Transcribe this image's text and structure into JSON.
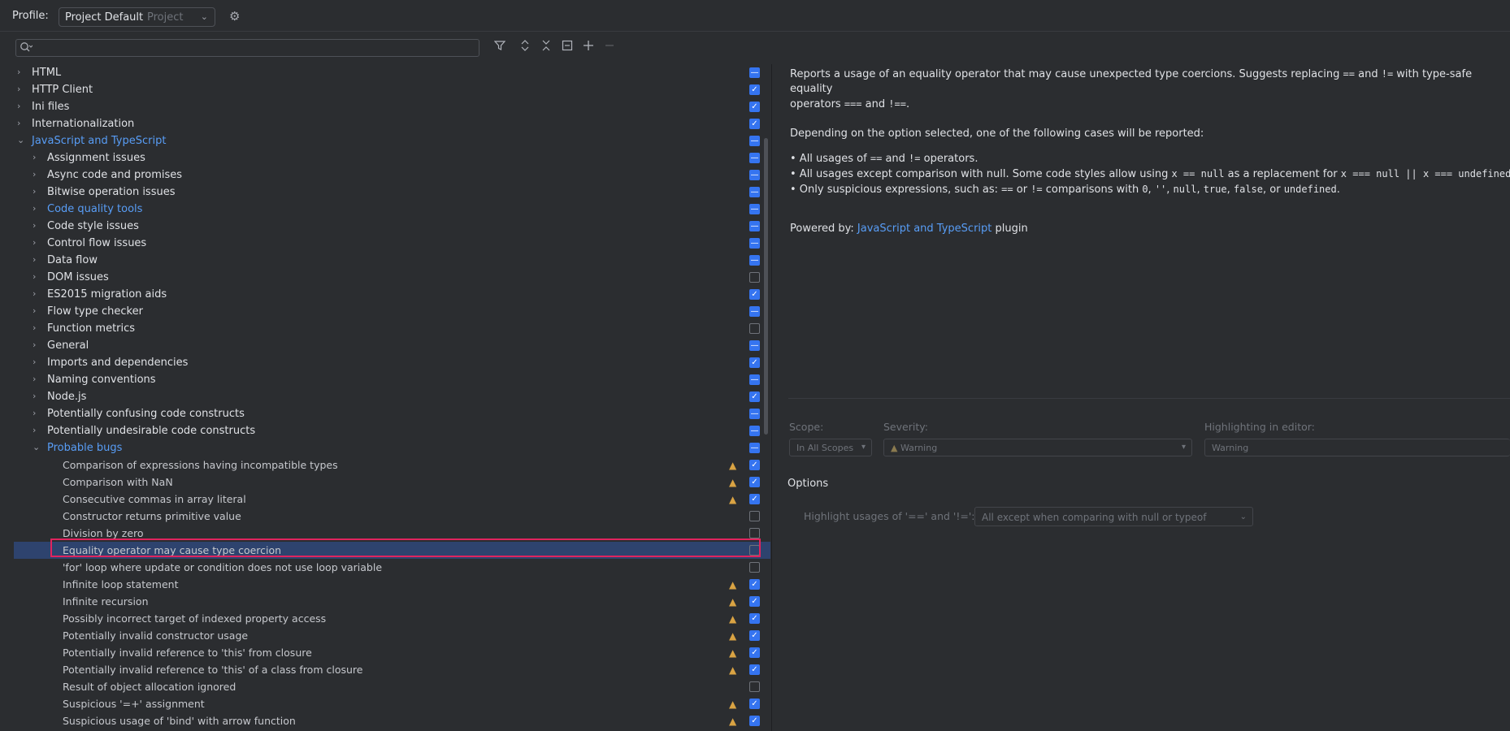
{
  "profile": {
    "label": "Profile:",
    "value": "Project Default",
    "scope": "Project"
  },
  "search": {
    "placeholder": ""
  },
  "tree": [
    {
      "label": "HTML",
      "level": 0,
      "chev": "right",
      "state": "mix"
    },
    {
      "label": "HTTP Client",
      "level": 0,
      "chev": "right",
      "state": "on"
    },
    {
      "label": "Ini files",
      "level": 0,
      "chev": "right",
      "state": "on"
    },
    {
      "label": "Internationalization",
      "level": 0,
      "chev": "right",
      "state": "on"
    },
    {
      "label": "JavaScript and TypeScript",
      "level": 0,
      "chev": "down",
      "state": "mix",
      "blue": true
    },
    {
      "label": "Assignment issues",
      "level": 1,
      "chev": "right",
      "state": "mix"
    },
    {
      "label": "Async code and promises",
      "level": 1,
      "chev": "right",
      "state": "mix"
    },
    {
      "label": "Bitwise operation issues",
      "level": 1,
      "chev": "right",
      "state": "mix"
    },
    {
      "label": "Code quality tools",
      "level": 1,
      "chev": "right",
      "state": "mix",
      "blue": true
    },
    {
      "label": "Code style issues",
      "level": 1,
      "chev": "right",
      "state": "mix"
    },
    {
      "label": "Control flow issues",
      "level": 1,
      "chev": "right",
      "state": "mix"
    },
    {
      "label": "Data flow",
      "level": 1,
      "chev": "right",
      "state": "mix"
    },
    {
      "label": "DOM issues",
      "level": 1,
      "chev": "right",
      "state": "off"
    },
    {
      "label": "ES2015 migration aids",
      "level": 1,
      "chev": "right",
      "state": "on"
    },
    {
      "label": "Flow type checker",
      "level": 1,
      "chev": "right",
      "state": "mix"
    },
    {
      "label": "Function metrics",
      "level": 1,
      "chev": "right",
      "state": "off"
    },
    {
      "label": "General",
      "level": 1,
      "chev": "right",
      "state": "mix"
    },
    {
      "label": "Imports and dependencies",
      "level": 1,
      "chev": "right",
      "state": "on"
    },
    {
      "label": "Naming conventions",
      "level": 1,
      "chev": "right",
      "state": "mix"
    },
    {
      "label": "Node.js",
      "level": 1,
      "chev": "right",
      "state": "on"
    },
    {
      "label": "Potentially confusing code constructs",
      "level": 1,
      "chev": "right",
      "state": "mix"
    },
    {
      "label": "Potentially undesirable code constructs",
      "level": 1,
      "chev": "right",
      "state": "mix"
    },
    {
      "label": "Probable bugs",
      "level": 1,
      "chev": "down",
      "state": "mix",
      "blue": true
    },
    {
      "label": "Comparison of expressions having incompatible types",
      "level": 2,
      "warn": true,
      "state": "on"
    },
    {
      "label": "Comparison with NaN",
      "level": 2,
      "warn": true,
      "state": "on"
    },
    {
      "label": "Consecutive commas in array literal",
      "level": 2,
      "warn": true,
      "state": "on"
    },
    {
      "label": "Constructor returns primitive value",
      "level": 2,
      "state": "off"
    },
    {
      "label": "Division by zero",
      "level": 2,
      "state": "off"
    },
    {
      "label": "Equality operator may cause type coercion",
      "level": 2,
      "state": "off",
      "selected": true
    },
    {
      "label": "'for' loop where update or condition does not use loop variable",
      "level": 2,
      "state": "off"
    },
    {
      "label": "Infinite loop statement",
      "level": 2,
      "warn": true,
      "state": "on"
    },
    {
      "label": "Infinite recursion",
      "level": 2,
      "warn": true,
      "state": "on"
    },
    {
      "label": "Possibly incorrect target of indexed property access",
      "level": 2,
      "warn": true,
      "state": "on"
    },
    {
      "label": "Potentially invalid constructor usage",
      "level": 2,
      "warn": true,
      "state": "on"
    },
    {
      "label": "Potentially invalid reference to 'this' from closure",
      "level": 2,
      "warn": true,
      "state": "on"
    },
    {
      "label": "Potentially invalid reference to 'this' of a class from closure",
      "level": 2,
      "warn": true,
      "state": "on"
    },
    {
      "label": "Result of object allocation ignored",
      "level": 2,
      "state": "off"
    },
    {
      "label": "Suspicious '=+' assignment",
      "level": 2,
      "warn": true,
      "state": "on"
    },
    {
      "label": "Suspicious usage of 'bind' with arrow function",
      "level": 2,
      "warn": true,
      "state": "on"
    }
  ],
  "description": {
    "p1a": "Reports a usage of an equality operator that may cause unexpected type coercions. Suggests replacing ",
    "eq": "==",
    "and": " and ",
    "neq": "!=",
    "p1b": " with type-safe equality",
    "p1c": "operators ",
    "seq": "===",
    "and2": " and ",
    "sneq": "!==",
    "dot": ".",
    "p2": "Depending on the option selected, one of the following cases will be reported:",
    "b1a": "• All usages of ",
    "b1b": " operators.",
    "b2a": "• All usages except comparison with null. Some code styles allow using ",
    "b2code1": "x == null",
    "b2b": " as a replacement for ",
    "b2code2": "x === null || x === undefined",
    "b3a": "• Only suspicious expressions, such as: ",
    "b3b": " or ",
    "b3c": " comparisons with ",
    "zero": "0",
    "empty": "''",
    "null": "null",
    "true": "true",
    "false": "false",
    "undef": "undefined",
    "comma": ", ",
    "or": ", or ",
    "powered": "Powered by: ",
    "plugin_link": "JavaScript and TypeScript",
    "plugin": " plugin"
  },
  "settings": {
    "scope_label": "Scope:",
    "scope_value": "In All Scopes",
    "severity_label": "Severity:",
    "severity_value": "Warning",
    "highlight_label": "Highlighting in editor:",
    "highlight_value": "Warning",
    "options_title": "Options",
    "option_label": "Highlight usages of '==' and '!=':",
    "option_value": "All except when comparing with null or typeof"
  }
}
